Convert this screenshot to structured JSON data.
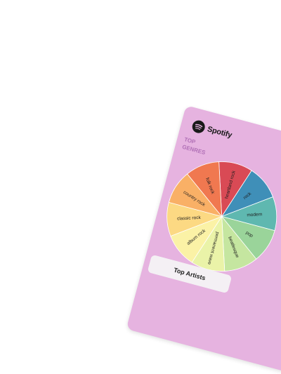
{
  "brand": {
    "name": "Spotify",
    "icon": "spotify-logo-icon"
  },
  "section": {
    "title_line1": "TOP",
    "title_line2": "GENRES"
  },
  "genres": [
    {
      "label": "heartland rock",
      "color": "#d94a55"
    },
    {
      "label": "rock",
      "color": "#3f8fb8"
    },
    {
      "label": "modern",
      "color": "#5fb8b0"
    },
    {
      "label": "pop",
      "color": "#9ad49a"
    },
    {
      "label": "beatlesque",
      "color": "#c5e6a0"
    },
    {
      "label": "permanent wave",
      "color": "#eaf3a8"
    },
    {
      "label": "album rock",
      "color": "#fbf2a6"
    },
    {
      "label": "classic rock",
      "color": "#fcd983"
    },
    {
      "label": "country rock",
      "color": "#f9b066"
    },
    {
      "label": "folk rock",
      "color": "#f07850"
    }
  ],
  "artists_button": {
    "label": "Top Artists"
  },
  "colors": {
    "card_background": "#e6b3e0",
    "title_accent": "#b06fb6"
  }
}
